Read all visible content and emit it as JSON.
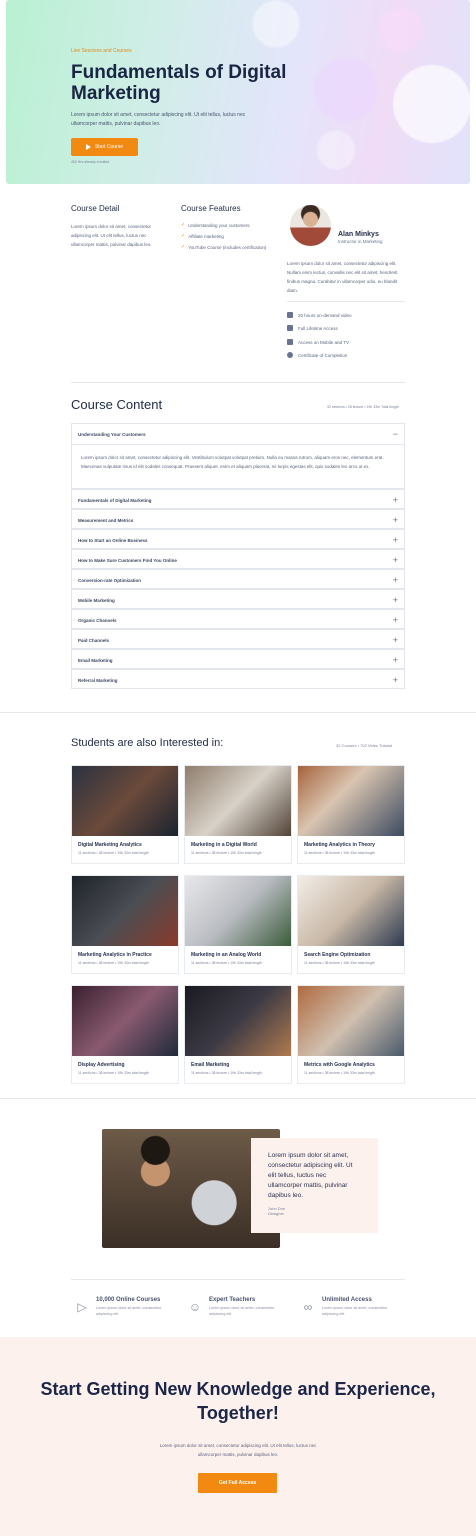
{
  "hero": {
    "eyebrow": "Live Sessions and Courses",
    "title": "Fundamentals of Digital Marketing",
    "description": "Lorem ipsum dolor sit amet, consectetur adipiscing elit. Ut elit tellus, luctus nec ullamcorper mattis, pulvinar dapibus leo.",
    "button": "Start Course",
    "note": "452 Hrs already enrolled"
  },
  "course_detail": {
    "title": "Course Detail",
    "text": "Lorem ipsum dolor sit amet, consectetur adipiscing elit. Ut elit tellus, luctus nec ullamcorper mattis, pulvinar dapibus leo."
  },
  "course_features": {
    "title": "Course Features",
    "items": [
      "Understanding your customers",
      "Affiliate marketing",
      "YouTube Course (includes certification)"
    ]
  },
  "instructor": {
    "name": "Alan Minkys",
    "role": "Instructor in Marketing",
    "bio": "Lorem ipsum dolor sit amet, consectetur adipiscing elit. Nullam enim lectus, convallis nec elit sit amet, hendrerit finibus magna. Curabitur in ullamcorper odio, eu blandit diam.",
    "meta": [
      {
        "icon": "document-icon",
        "text": "20 hours on-demand video"
      },
      {
        "icon": "key-icon",
        "text": "Full Lifetime Access"
      },
      {
        "icon": "monitor-icon",
        "text": "Access on Mobile and TV"
      },
      {
        "icon": "badge-icon",
        "text": "Certificate of Completion"
      }
    ]
  },
  "content": {
    "title": "Course Content",
    "meta": "32 sections • 28 lecture • 19h 33m Total length",
    "open_item": {
      "label": "Understanding Your Customers",
      "body": "Lorem ipsum dolor sit amet, consectetur adipiscing elit. Vestibulum volutpat volutpat pretium. Nulla eu massa rutrum, aliquam eros nec, elementum erat. Maecenas vulputate risus id elit sodales consequat. Praesent aliquet, enim et aliquam placerat, mi turpis egestas elit, quis sodales leo arcu ut ex."
    },
    "items": [
      "Fundamentals of Digital Marketing",
      "Measurement and Metrics",
      "How to Start an Online Business",
      "How to Make Sure Customers Find You Online",
      "Conversion-rate Optimization",
      "Mobile Marketing",
      "Organic Channels",
      "Paid Channels",
      "Email Marketing",
      "Referral Marketing"
    ]
  },
  "related": {
    "title": "Students are also Interested in:",
    "meta": "32 Courses • 702 Video Tutorial",
    "card_meta": "11 sections • 38 lecture • 19h 33m total length",
    "cards": [
      "Digital Marketing Analytics",
      "Marketing in a Digital World",
      "Marketing Analytics in Theory",
      "Marketing Analytics in Practice",
      "Marketing in an Analog World",
      "Search Engine Optimization",
      "Display Advertising",
      "Email Marketing",
      "Metrics with Google Analytics"
    ]
  },
  "testimonial": {
    "quote": "Lorem ipsum dolor sit amet, consectetur adipiscing elit. Ut elit tellus, luctus nec ullamcorper mattis, pulvinar dapibus leo.",
    "name": "John Doe",
    "role": "Designer"
  },
  "stats": [
    {
      "icon": "play-icon",
      "title": "10,000 Online Courses",
      "text": "Lorem ipsum dolor sit amet, consectetur adipiscing elit."
    },
    {
      "icon": "teacher-icon",
      "title": "Expert Teachers",
      "text": "Lorem ipsum dolor sit amet, consectetur adipiscing elit."
    },
    {
      "icon": "infinity-icon",
      "title": "Unlimited Access",
      "text": "Lorem ipsum dolor sit amet, consectetur adipiscing elit."
    }
  ],
  "cta": {
    "title": "Start Getting New Knowledge and Experience, Together!",
    "text": "Lorem ipsum dolor sit amet, consectetur adipiscing elit. Ut elit tellus, luctus nec ullamcorper mattis, pulvinar dapibus leo.",
    "button": "Get Full Access"
  }
}
